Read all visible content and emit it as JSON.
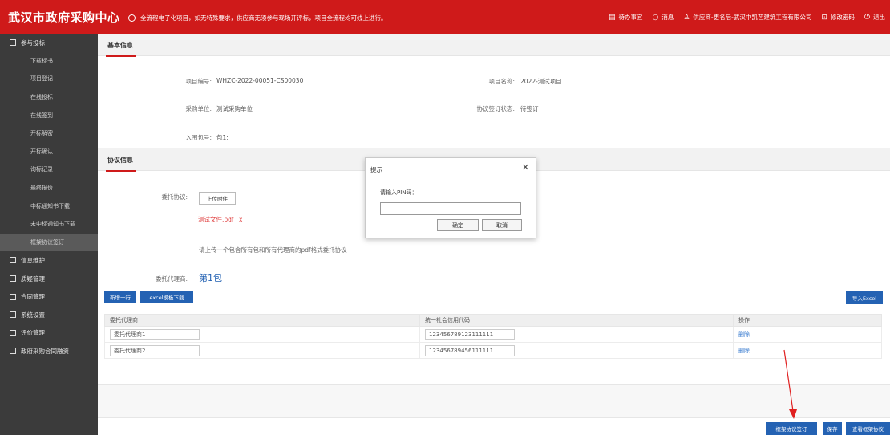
{
  "app": {
    "title": "武汉市政府采购中心"
  },
  "topbar": {
    "notice": "全流程电子化项目，如无特殊要求，供应商无须参与现场开评标，项目全流程均可线上进行。",
    "nav": [
      {
        "label": "待办事宜",
        "icon": "todo-icon"
      },
      {
        "label": "消息",
        "icon": "search-icon"
      },
      {
        "label": "供应商-更名后-武汉中凯艺建筑工程有限公司",
        "icon": "user-icon"
      },
      {
        "label": "修改密码",
        "icon": "lock-icon"
      },
      {
        "label": "退出",
        "icon": "power-icon"
      }
    ]
  },
  "sidebar": {
    "group1": "参与投标",
    "sub": [
      "下载标书",
      "项目登记",
      "在线投标",
      "在线签到",
      "开标解密",
      "开标确认",
      "询标记录",
      "最终报价",
      "中标通知书下载",
      "未中标通知书下载",
      "框架协议签订"
    ],
    "groups": [
      "信息维护",
      "质疑管理",
      "合同管理",
      "系统设置",
      "评价管理",
      "政府采购合同融资"
    ]
  },
  "basic": {
    "title": "基本信息",
    "project_no_label": "项目编号:",
    "project_no": "WHZC-2022-00051-CS00030",
    "project_name_label": "项目名称:",
    "project_name": "2022-测试项目",
    "purchaser_label": "采购单位:",
    "purchaser": "测试采购单位",
    "sign_status_label": "协议签订状态:",
    "sign_status": "待签订",
    "package_label": "入围包号:",
    "package": "包1;"
  },
  "agreement": {
    "title": "协议信息",
    "delegate_label": "委托协议:",
    "upload_btn": "上传附件",
    "file_name": "测试文件.pdf",
    "file_remove": "x",
    "hint": "请上传一个包含所有包和所有代理商的pdf格式委托协议",
    "agent_label": "委托代理商:",
    "agent_package": "第1包",
    "add_row_btn": "新增一行",
    "excel_template_btn": "excel模板下载",
    "import_excel_btn": "导入Excel"
  },
  "table": {
    "headers": [
      "委托代理商",
      "统一社会信用代码",
      "操作"
    ],
    "rows": [
      {
        "agent": "委托代理商1",
        "code": "123456789123111111",
        "action": "删除"
      },
      {
        "agent": "委托代理商2",
        "code": "123456789456111111",
        "action": "删除"
      }
    ]
  },
  "footer": {
    "sign_btn": "框架协议签订",
    "save_btn": "保存",
    "view_btn": "查看框架协议"
  },
  "dialog": {
    "title": "提示",
    "close": "✕",
    "prompt": "请输入PIN码：",
    "input_value": "",
    "ok": "确定",
    "cancel": "取消"
  },
  "colors": {
    "brand_red": "#cf1a1a",
    "sidebar": "#3b3b3b",
    "accent_blue": "#2462b3"
  }
}
